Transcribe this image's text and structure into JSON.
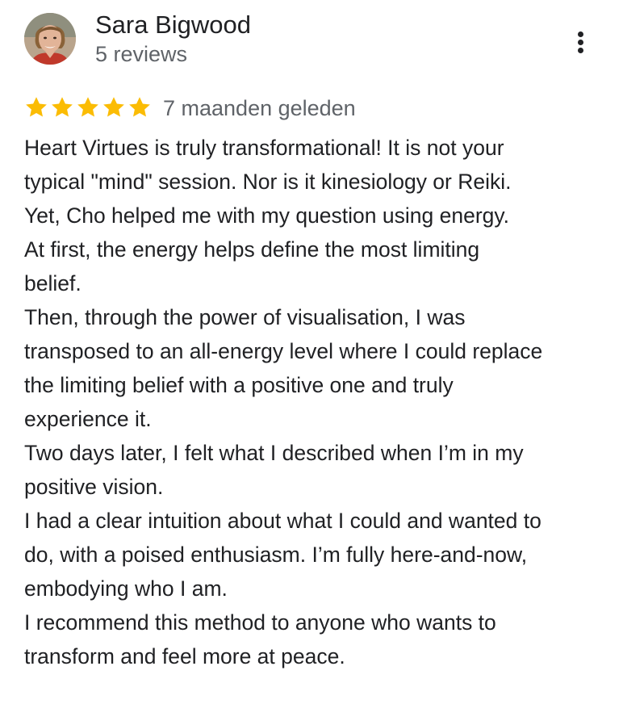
{
  "reviewer": {
    "name": "Sara Bigwood",
    "review_count": "5 reviews",
    "avatar_icon": "profile-photo"
  },
  "menu": {
    "icon": "more-vert-icon"
  },
  "rating": {
    "stars": 5,
    "max_stars": 5,
    "star_color": "#FBBC04",
    "date": "7 maanden geleden"
  },
  "review": {
    "lines": [
      "Heart Virtues is truly transformational! It is not your",
      "typical \"mind\" session. Nor is it kinesiology or Reiki.",
      "Yet, Cho helped me with my question using energy.",
      "At first, the energy helps define the most limiting",
      "belief.",
      "Then, through the power of visualisation, I was",
      "transposed to an all-energy level where I could replace",
      "the limiting belief with a positive one and truly",
      "experience it.",
      "Two days later, I felt what I described when I’m in my",
      "positive vision.",
      "I had a clear intuition about what I could and wanted to",
      "do, with a poised enthusiasm. I’m fully here-and-now,",
      "embodying who I am.",
      "I recommend this method to anyone who wants to",
      "transform and feel more at peace."
    ]
  },
  "colors": {
    "text_primary": "#202124",
    "text_secondary": "#5f6368",
    "link": "#1a73e8"
  }
}
